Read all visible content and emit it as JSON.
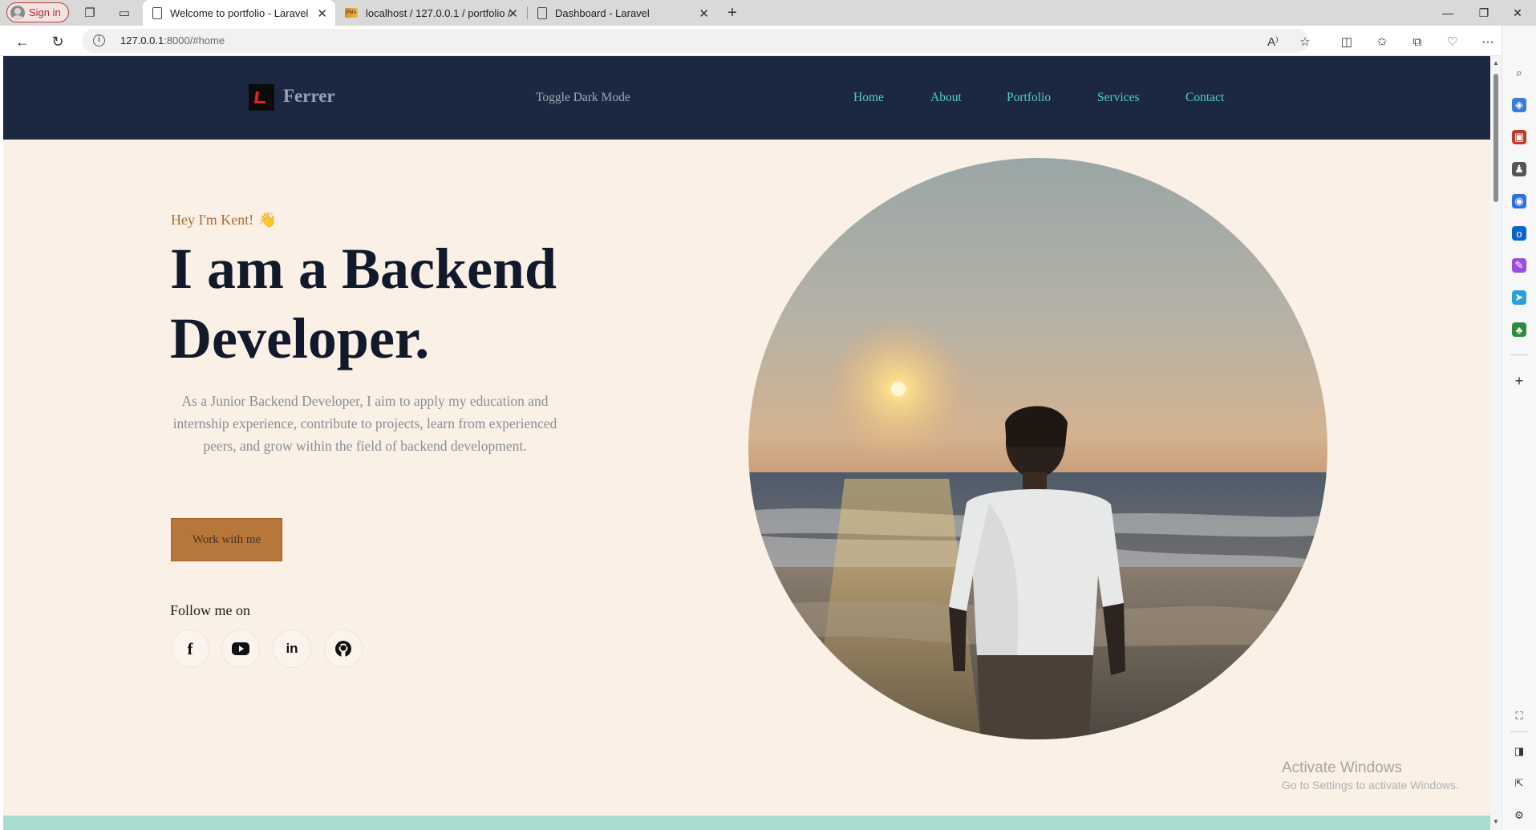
{
  "browser": {
    "profile_label": "Sign in",
    "tabs": [
      {
        "title": "Welcome to portfolio - Laravel",
        "active": true
      },
      {
        "title": "localhost / 127.0.0.1 / portfolio /",
        "active": false
      },
      {
        "title": "Dashboard - Laravel",
        "active": false
      }
    ],
    "url_host": "127.0.0.1",
    "url_rest": ":8000/#home"
  },
  "site": {
    "brand": "Ferrer",
    "toggle_dark_mode": "Toggle Dark Mode",
    "menu": [
      "Home",
      "About",
      "Portfolio",
      "Services",
      "Contact"
    ]
  },
  "hero": {
    "greeting": "Hey I'm Kent!",
    "greeting_emoji": "👋",
    "headline_line1": "I am a Backend",
    "headline_line2": "Developer.",
    "description": "As a Junior Backend Developer, I aim to apply my education and internship experience, contribute to projects, learn from experienced peers, and grow within the field of backend development.",
    "cta_label": "Work with me",
    "follow_label": "Follow me on",
    "socials": [
      {
        "name": "facebook",
        "glyph": "f"
      },
      {
        "name": "youtube",
        "glyph": "▶"
      },
      {
        "name": "linkedin",
        "glyph": "in"
      },
      {
        "name": "github",
        "glyph": "⌾"
      }
    ]
  },
  "os": {
    "activate_title": "Activate Windows",
    "activate_subtitle": "Go to Settings to activate Windows."
  },
  "colors": {
    "nav_bg": "#1c2841",
    "page_bg": "#faf0e6",
    "accent_teal": "#4fd1c5",
    "cta_bg": "#b7763a",
    "headline": "#111a2c"
  }
}
